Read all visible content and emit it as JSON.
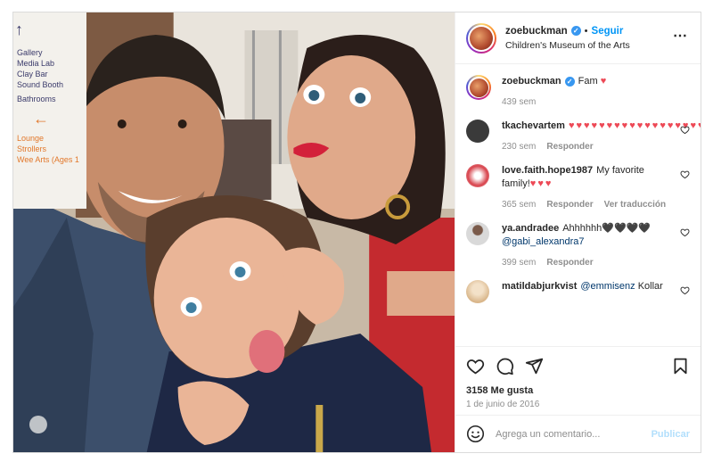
{
  "post": {
    "author": {
      "username": "zoebuckman",
      "verified": true,
      "follow_label": "Seguir",
      "location": "Children's Museum of the Arts"
    },
    "caption": {
      "username": "zoebuckman",
      "text": "Fam",
      "time": "439 sem"
    },
    "photo_sign": [
      "Gallery",
      "Media Lab",
      "Clay Bar",
      "Sound Booth",
      "Bathrooms",
      "Lounge",
      "Strollers",
      "Wee Arts (Ages 1"
    ],
    "comments": [
      {
        "username": "tkachevartem",
        "text": "",
        "hearts": "♥♥♥♥♥♥♥♥♥♥♥♥♥♥♥♥♥♥♥♥♥♥♥♥♥♥",
        "time": "230 sem",
        "reply_label": "Responder",
        "avatar_color": "#3a3a3a"
      },
      {
        "username": "love.faith.hope1987",
        "text": "My favorite family!",
        "hearts": "♥♥♥",
        "time": "365 sem",
        "reply_label": "Responder",
        "translate_label": "Ver traducción",
        "avatar_color": "#d8444d"
      },
      {
        "username": "ya.andradee",
        "text": "Ahhhhhh🖤🖤🖤🖤",
        "mention": "@gabi_alexandra7",
        "time": "399 sem",
        "reply_label": "Responder",
        "avatar_color": "#c7c7c7"
      },
      {
        "username": "matildabjurkvist",
        "mention": "@emmisenz",
        "text": "Kollar",
        "avatar_color": "#d9b68a"
      }
    ],
    "likes": "3158 Me gusta",
    "date": "1 de junio de 2016",
    "add_comment": {
      "placeholder": "Agrega un comentario...",
      "publish_label": "Publicar"
    },
    "icons": [
      "more-icon",
      "heart-icon",
      "comment-icon",
      "share-icon",
      "save-icon",
      "emoji-icon"
    ],
    "colors": {
      "accent": "#0095f6",
      "heart": "#ed4956",
      "muted": "#8e8e8e",
      "publish_disabled": "#b2dffc"
    }
  }
}
